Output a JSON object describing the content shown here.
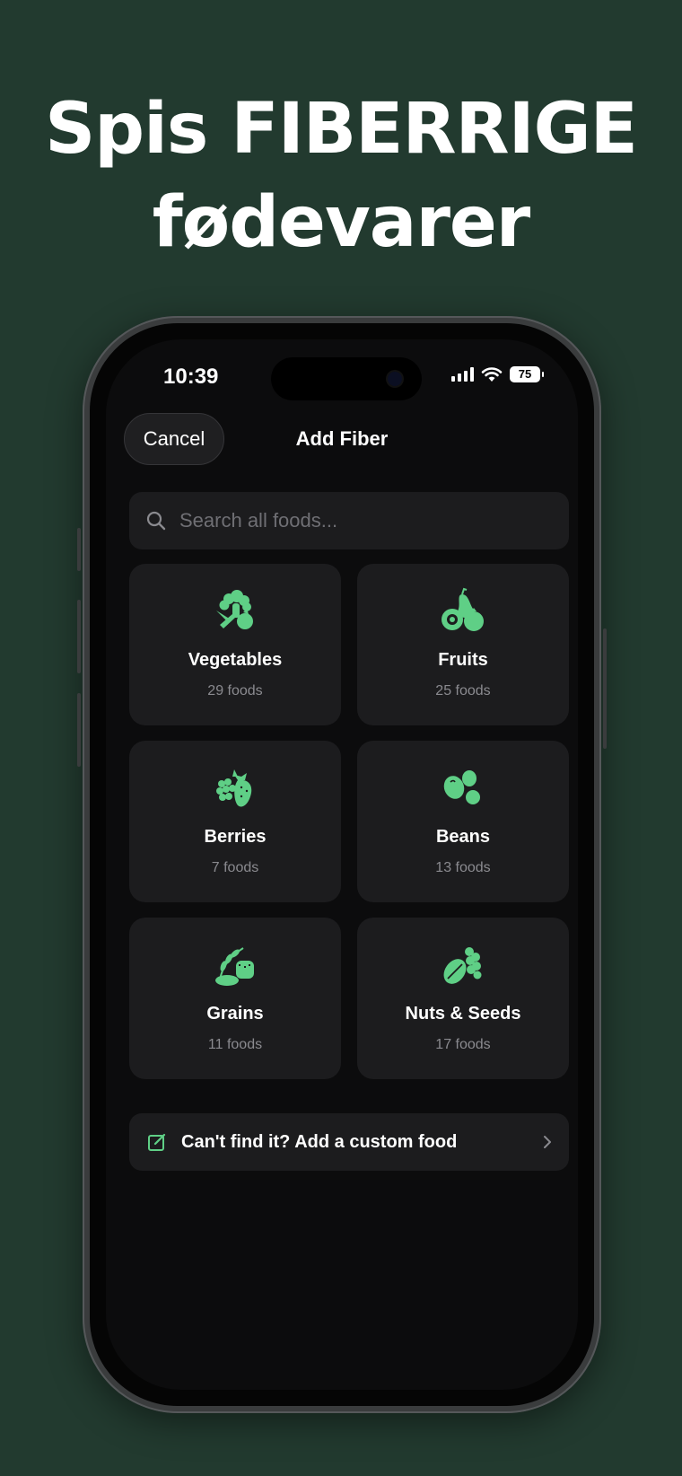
{
  "headline": {
    "line1": "Spis FIBERRIGE",
    "line2": "fødevarer"
  },
  "status_bar": {
    "time": "10:39",
    "battery": "75"
  },
  "nav": {
    "cancel_label": "Cancel",
    "title": "Add Fiber"
  },
  "search": {
    "placeholder": "Search all foods..."
  },
  "categories": [
    {
      "name": "Vegetables",
      "count": "29 foods",
      "icon": "vegetables-icon"
    },
    {
      "name": "Fruits",
      "count": "25 foods",
      "icon": "fruits-icon"
    },
    {
      "name": "Berries",
      "count": "7 foods",
      "icon": "berries-icon"
    },
    {
      "name": "Beans",
      "count": "13 foods",
      "icon": "beans-icon"
    },
    {
      "name": "Grains",
      "count": "11 foods",
      "icon": "grains-icon"
    },
    {
      "name": "Nuts & Seeds",
      "count": "17 foods",
      "icon": "nuts-seeds-icon"
    }
  ],
  "custom_food": {
    "label": "Can't find it? Add a custom food"
  },
  "colors": {
    "background": "#223a2f",
    "accent": "#5fcf86",
    "card": "#1c1c1e",
    "screen": "#0c0c0d"
  }
}
